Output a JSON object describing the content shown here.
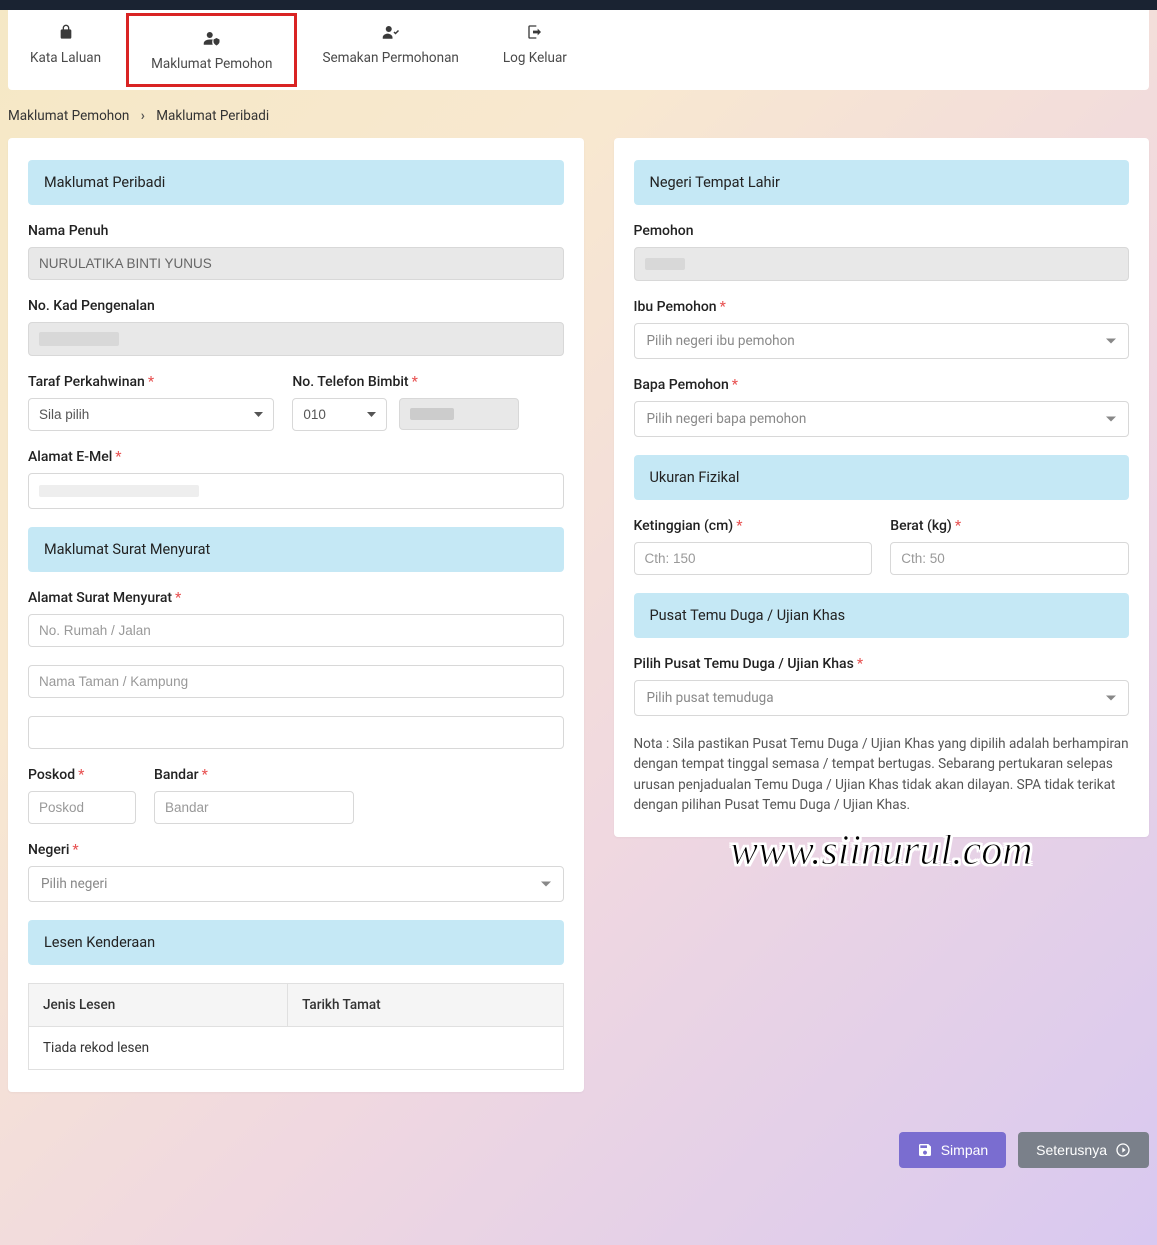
{
  "nav": {
    "password": "Kata Laluan",
    "applicant_info": "Maklumat Pemohon",
    "check_application": "Semakan Permohonan",
    "logout": "Log Keluar"
  },
  "breadcrumb": {
    "parent": "Maklumat Pemohon",
    "current": "Maklumat Peribadi"
  },
  "sections": {
    "personal": "Maklumat Peribadi",
    "mailing": "Maklumat Surat Menyurat",
    "license": "Lesen Kenderaan",
    "birth_state": "Negeri Tempat Lahir",
    "physical": "Ukuran Fizikal",
    "interview": "Pusat Temu Duga / Ujian Khas"
  },
  "labels": {
    "full_name": "Nama Penuh",
    "ic_no": "No. Kad Pengenalan",
    "marital": "Taraf Perkahwinan",
    "mobile": "No. Telefon Bimbit",
    "email": "Alamat E-Mel",
    "mailing_address": "Alamat Surat Menyurat",
    "postcode": "Poskod",
    "city": "Bandar",
    "state": "Negeri",
    "applicant": "Pemohon",
    "mother": "Ibu Pemohon",
    "father": "Bapa Pemohon",
    "height": "Ketinggian (cm)",
    "weight": "Berat (kg)",
    "interview_center": "Pilih Pusat Temu Duga / Ujian Khas",
    "license_type": "Jenis Lesen",
    "license_expiry": "Tarikh Tamat"
  },
  "values": {
    "full_name": "NURULATIKA BINTI YUNUS",
    "marital_select": "Sila pilih",
    "phone_prefix": "010",
    "state_select": "Pilih negeri",
    "mother_select": "Pilih negeri ibu pemohon",
    "father_select": "Pilih negeri bapa pemohon",
    "interview_select": "Pilih pusat temuduga",
    "license_empty": "Tiada rekod lesen"
  },
  "placeholders": {
    "addr1": "No. Rumah / Jalan",
    "addr2": "Nama Taman / Kampung",
    "postcode": "Poskod",
    "city": "Bandar",
    "height": "Cth: 150",
    "weight": "Cth: 50"
  },
  "note": "Nota : Sila pastikan Pusat Temu Duga / Ujian Khas yang dipilih adalah berhampiran dengan tempat tinggal semasa / tempat bertugas. Sebarang pertukaran selepas urusan penjadualan Temu Duga / Ujian Khas tidak akan dilayan. SPA tidak terikat dengan pilihan Pusat Temu Duga / Ujian Khas.",
  "watermark": "www.siinurul.com",
  "buttons": {
    "save": "Simpan",
    "next": "Seterusnya"
  }
}
